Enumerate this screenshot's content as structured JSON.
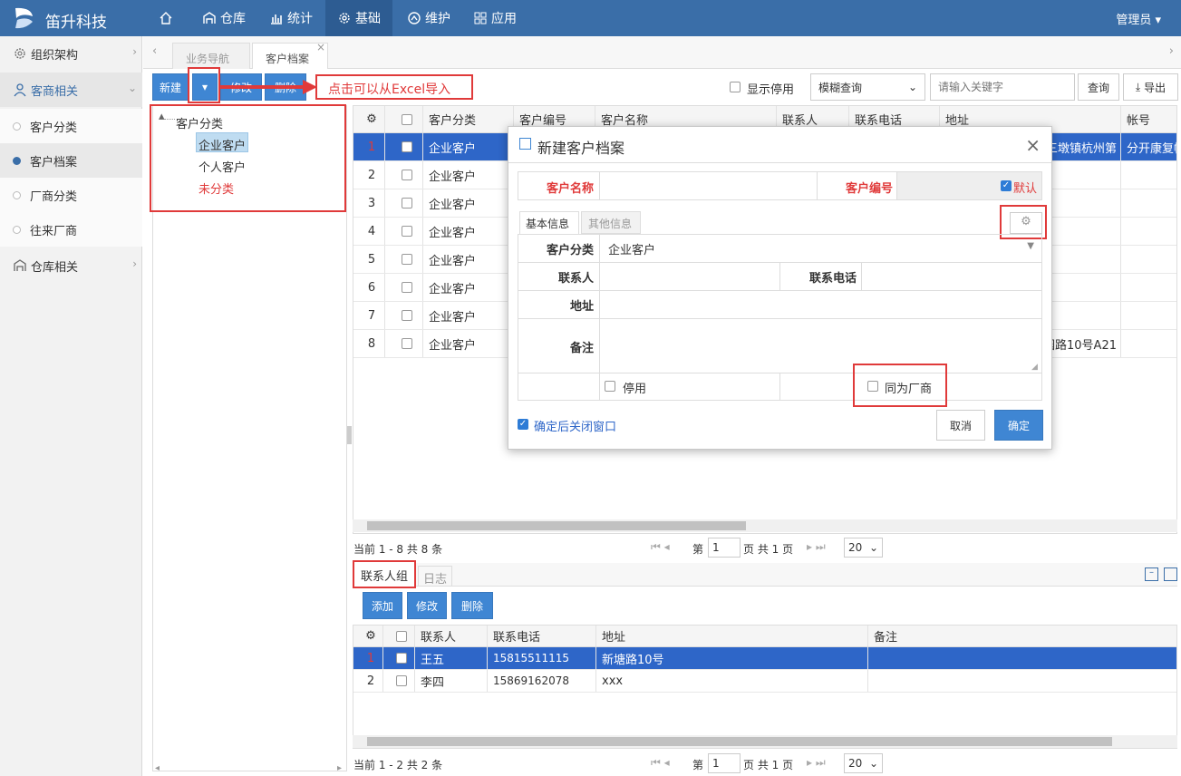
{
  "brand": "笛升科技",
  "nav": [
    {
      "label": "",
      "icon": "home-icon"
    },
    {
      "label": "仓库",
      "icon": "warehouse-icon"
    },
    {
      "label": "统计",
      "icon": "chart-icon"
    },
    {
      "label": "基础",
      "icon": "gear-icon"
    },
    {
      "label": "维护",
      "icon": "maintain-icon"
    },
    {
      "label": "应用",
      "icon": "apps-icon"
    }
  ],
  "admin": "管理员 ▾",
  "sidebar": {
    "items": [
      {
        "label": "组织架构"
      },
      {
        "label": "客商相关"
      },
      {
        "label": "客户分类"
      },
      {
        "label": "客户档案"
      },
      {
        "label": "厂商分类"
      },
      {
        "label": "往来厂商"
      },
      {
        "label": "仓库相关"
      }
    ]
  },
  "tabs": [
    {
      "label": "业务导航"
    },
    {
      "label": "客户档案"
    }
  ],
  "toolbar": {
    "new": "新建",
    "dropdown": "▾",
    "edit": "修改",
    "delete": "删除",
    "annotation": "点击可以从Excel导入",
    "show_disabled": "显示停用",
    "search_mode": "模糊查询",
    "search_placeholder": "请输入关键字",
    "query": "查询",
    "export": "导出"
  },
  "tree": {
    "root": "客户分类",
    "children": [
      "企业客户",
      "个人客户",
      "未分类"
    ]
  },
  "grid": {
    "headers": [
      "客户分类",
      "客户编号",
      "客户名称",
      "联系人",
      "联系电话",
      "地址",
      "帐号"
    ],
    "rows": [
      {
        "no": "1",
        "cat": "企业客户",
        "addr": "三墩镇杭州第",
        "acct": "分开康复帐"
      },
      {
        "no": "2",
        "cat": "企业客户",
        "addr": "",
        "acct": ""
      },
      {
        "no": "3",
        "cat": "企业客户",
        "addr": "",
        "acct": ""
      },
      {
        "no": "4",
        "cat": "企业客户",
        "addr": "",
        "acct": ""
      },
      {
        "no": "5",
        "cat": "企业客户",
        "addr": "",
        "acct": ""
      },
      {
        "no": "6",
        "cat": "企业客户",
        "addr": "",
        "acct": ""
      },
      {
        "no": "7",
        "cat": "企业客户",
        "addr": "",
        "acct": ""
      },
      {
        "no": "8",
        "cat": "企业客户",
        "addr": "园路10号A21",
        "acct": ""
      }
    ]
  },
  "pager1": {
    "info": "当前 1 - 8 共 8 条",
    "page_label": "第",
    "page": "1",
    "total": "页 共 1 页",
    "size": "20"
  },
  "bottom_tabs": [
    "联系人组",
    "日志"
  ],
  "bottom_toolbar": {
    "add": "添加",
    "edit": "修改",
    "delete": "删除"
  },
  "contacts": {
    "headers": [
      "联系人",
      "联系电话",
      "地址",
      "备注"
    ],
    "rows": [
      {
        "no": "1",
        "name": "王五",
        "phone": "15815511115",
        "addr": "新塘路10号",
        "note": ""
      },
      {
        "no": "2",
        "name": "李四",
        "phone": "15869162078",
        "addr": "xxx",
        "note": ""
      }
    ]
  },
  "pager2": {
    "info": "当前 1 - 2 共 2 条",
    "page_label": "第",
    "page": "1",
    "total": "页 共 1 页",
    "size": "20"
  },
  "modal": {
    "title": "新建客户档案",
    "name_label": "客户名称",
    "code_label": "客户编号",
    "default_label": "默认",
    "tab_basic": "基本信息",
    "tab_other": "其他信息",
    "cat_label": "客户分类",
    "cat_value": "企业客户",
    "contact_label": "联系人",
    "phone_label": "联系电话",
    "addr_label": "地址",
    "note_label": "备注",
    "disable_label": "停用",
    "supplier_label": "同为厂商",
    "close_after": "确定后关闭窗口",
    "cancel": "取消",
    "ok": "确定"
  },
  "colors": {
    "topbar": "#3a6ea8",
    "primary": "#3f86d3",
    "select": "#2e66c8",
    "highlight": "#e03a3a"
  }
}
